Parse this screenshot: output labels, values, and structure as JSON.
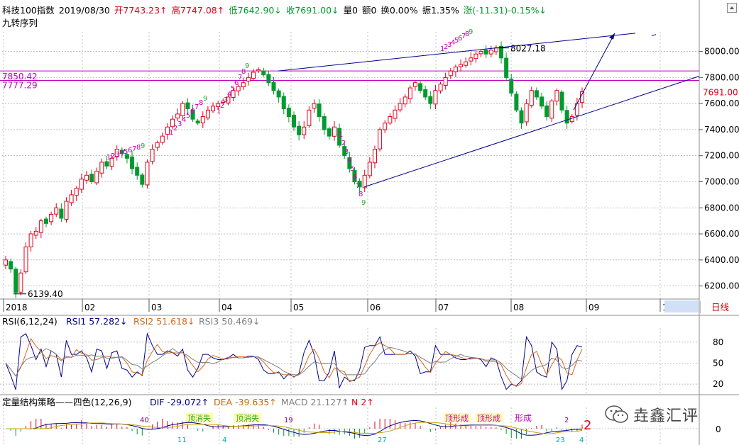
{
  "header": {
    "instrument": "科技100指数",
    "date": "2019/08/30",
    "open": "开7743.23↑",
    "high": "高7747.08↑",
    "low": "低7642.90↓",
    "close": "收7691.00↓",
    "volume": "量0",
    "amount": "额0",
    "turnover": "换0.00%",
    "amplitude": "振1.35%",
    "change": "涨(-11.31)-0.15%↓",
    "indicator_label": "九转序列"
  },
  "main_panel": {
    "price_axis": [
      "8000.00",
      "7800.00",
      "7600.00",
      "7400.00",
      "7200.00",
      "7000.00",
      "6800.00",
      "6600.00",
      "6400.00",
      "6200.00"
    ],
    "current_price": "7691.00",
    "level_labels": [
      "7850.42",
      "7777.29"
    ],
    "annotations": {
      "high": "8027.18",
      "low": "6139.40"
    },
    "time_axis": [
      "2018",
      "02",
      "03",
      "04",
      "05",
      "06",
      "07",
      "08",
      "09",
      "10"
    ],
    "period_button": "日线",
    "sequence_counts": [
      "1",
      "2",
      "3",
      "4",
      "5",
      "6",
      "7",
      "8",
      "9"
    ],
    "colors": {
      "up": "#e0001b",
      "down": "#009a2e",
      "trend": "#00008b",
      "level": "#c000c0",
      "grid": "#9a9a9a",
      "seq_red": "#c000c0",
      "seq_green": "#2ca82c"
    }
  },
  "rsi_panel": {
    "title": "RSI(6,12,24)",
    "rsi1": "RSI1 57.282↓",
    "rsi2": "RSI2 51.618↓",
    "rsi3": "RSI3 50.469↓",
    "axis": [
      "80",
      "50",
      "20"
    ],
    "colors": {
      "rsi1": "#00008b",
      "rsi2": "#d2691e",
      "rsi3": "#808080"
    }
  },
  "macd_panel": {
    "title": "定量结构策略——四色(12,26,9)",
    "dif": "DIF -29.072↑",
    "dea": "DEA -39.635↑",
    "macd": "MACD 21.127↑",
    "n": "N 2↑",
    "axis": [
      "0"
    ],
    "marks_top": [
      "40",
      "19",
      "2"
    ],
    "marks_bottom": [
      "11",
      "4",
      "27",
      "23",
      "4"
    ],
    "big_mark": "2",
    "tag_texts": [
      "顶消失",
      "顶消失",
      "顶形成",
      "顶形成"
    ]
  },
  "watermark": {
    "text": "垚鑫汇评"
  },
  "chart_data": [
    {
      "type": "candlestick",
      "title": "科技100指数",
      "period": "日线",
      "x": [
        "2018",
        "02",
        "03",
        "04",
        "05",
        "06",
        "07",
        "08",
        "09",
        "10"
      ],
      "ylim": [
        6100,
        8150
      ],
      "ohlc_last": {
        "date": "2019/08/30",
        "open": 7743.23,
        "high": 7747.08,
        "low": 7642.9,
        "close": 7691.0
      },
      "swing_high": 8027.18,
      "swing_low": 6139.4,
      "levels": [
        7850.42,
        7777.29
      ],
      "close_trace": [
        6400,
        6330,
        6150,
        6300,
        6500,
        6600,
        6620,
        6700,
        6680,
        6750,
        6800,
        6720,
        6850,
        6900,
        6950,
        7020,
        7050,
        7000,
        7080,
        7150,
        7120,
        7180,
        7250,
        7220,
        7180,
        7100,
        7050,
        6980,
        7150,
        7250,
        7300,
        7350,
        7420,
        7480,
        7520,
        7600,
        7560,
        7480,
        7450,
        7500,
        7550,
        7580,
        7600,
        7620,
        7650,
        7700,
        7730,
        7760,
        7800,
        7840,
        7860,
        7820,
        7760,
        7700,
        7650,
        7560,
        7500,
        7420,
        7360,
        7420,
        7550,
        7600,
        7500,
        7400,
        7350,
        7420,
        7280,
        7200,
        7100,
        7000,
        6960,
        7050,
        7150,
        7250,
        7400,
        7450,
        7500,
        7550,
        7600,
        7650,
        7720,
        7760,
        7700,
        7650,
        7600,
        7700,
        7750,
        7800,
        7850,
        7880,
        7900,
        7920,
        7950,
        7980,
        8000,
        7980,
        8010,
        8027,
        7950,
        7800,
        7680,
        7550,
        7450,
        7600,
        7700,
        7650,
        7580,
        7500,
        7620,
        7700,
        7550,
        7450,
        7500,
        7600,
        7691
      ]
    },
    {
      "type": "line",
      "title": "RSI(6,12,24)",
      "ylim": [
        10,
        100
      ],
      "series": [
        {
          "name": "RSI1",
          "last": 57.282
        },
        {
          "name": "RSI2",
          "last": 51.618
        },
        {
          "name": "RSI3",
          "last": 50.469
        }
      ]
    },
    {
      "type": "bar",
      "title": "定量结构策略——四色(12,26,9)",
      "series": [
        {
          "name": "DIF",
          "last": -29.072
        },
        {
          "name": "DEA",
          "last": -39.635
        },
        {
          "name": "MACD",
          "last": 21.127
        },
        {
          "name": "N",
          "last": 2
        }
      ]
    }
  ]
}
